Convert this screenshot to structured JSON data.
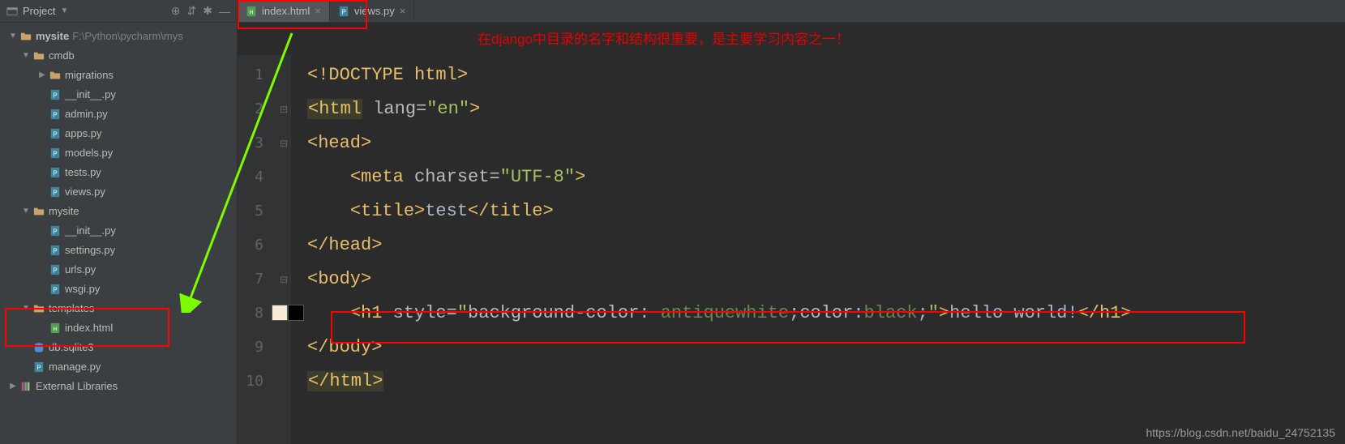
{
  "project_panel": {
    "title": "Project",
    "root": {
      "name": "mysite",
      "path": "F:\\Python\\pycharm\\mys"
    },
    "tree": [
      {
        "label": "cmdb",
        "type": "folder",
        "indent": 1,
        "expanded": true
      },
      {
        "label": "migrations",
        "type": "folder",
        "indent": 2,
        "expanded": false
      },
      {
        "label": "__init__.py",
        "type": "py",
        "indent": 2
      },
      {
        "label": "admin.py",
        "type": "py",
        "indent": 2
      },
      {
        "label": "apps.py",
        "type": "py",
        "indent": 2
      },
      {
        "label": "models.py",
        "type": "py",
        "indent": 2
      },
      {
        "label": "tests.py",
        "type": "py",
        "indent": 2
      },
      {
        "label": "views.py",
        "type": "py",
        "indent": 2
      },
      {
        "label": "mysite",
        "type": "folder",
        "indent": 1,
        "expanded": true
      },
      {
        "label": "__init__.py",
        "type": "py",
        "indent": 2
      },
      {
        "label": "settings.py",
        "type": "py",
        "indent": 2
      },
      {
        "label": "urls.py",
        "type": "py",
        "indent": 2
      },
      {
        "label": "wsgi.py",
        "type": "py",
        "indent": 2
      },
      {
        "label": "templates",
        "type": "folder",
        "indent": 1,
        "expanded": true
      },
      {
        "label": "index.html",
        "type": "html",
        "indent": 2
      },
      {
        "label": "db.sqlite3",
        "type": "db",
        "indent": 1
      },
      {
        "label": "manage.py",
        "type": "py",
        "indent": 1
      }
    ],
    "external_libs": "External Libraries"
  },
  "tabs": [
    {
      "label": "index.html",
      "icon": "html",
      "active": true
    },
    {
      "label": "views.py",
      "icon": "py",
      "active": false
    }
  ],
  "annotation_text": "在django中目录的名字和结构很重要，是主要学习内容之一！",
  "code": {
    "lines": [
      {
        "n": 1,
        "html": "<span class='tag'>&lt;!DOCTYPE html&gt;</span>"
      },
      {
        "n": 2,
        "html": "<span class='tag-open'>&lt;html</span> <span class='attr-name'>lang=</span><span class='attr-val'>\"en\"</span><span class='tag'>&gt;</span>"
      },
      {
        "n": 3,
        "html": "<span class='tag'>&lt;head&gt;</span>"
      },
      {
        "n": 4,
        "html": "    <span class='tag'>&lt;meta</span> <span class='attr-name'>charset=</span><span class='attr-val'>\"UTF-8\"</span><span class='tag'>&gt;</span>"
      },
      {
        "n": 5,
        "html": "    <span class='tag'>&lt;title&gt;</span><span class='text'>test</span><span class='tag'>&lt;/title&gt;</span>"
      },
      {
        "n": 6,
        "html": "<span class='tag'>&lt;/head&gt;</span>"
      },
      {
        "n": 7,
        "html": "<span class='tag'>&lt;body&gt;</span>"
      },
      {
        "n": 8,
        "html": "    <span class='tag'>&lt;h1</span> <span class='attr-name'>style=</span><span class='attr-val'>\"</span><span class='attr-name'>background-color</span><span class='text'>: </span><span class='attr-val2'>antiquewhite</span><span class='text'>;</span><span class='attr-name'>color</span><span class='text'>:</span><span class='attr-val2'>black</span><span class='text'>;</span><span class='attr-val'>\"</span><span class='tag'>&gt;</span><span class='text'>hello world!</span><span class='tag'>&lt;/h1&gt;</span>"
      },
      {
        "n": 9,
        "html": "<span class='tag'>&lt;/body&gt;</span>"
      },
      {
        "n": 10,
        "html": "<span class='tag-open'>&lt;/html&gt;</span>"
      }
    ],
    "fold_marks": [
      false,
      true,
      true,
      false,
      false,
      false,
      true,
      false,
      false,
      false
    ],
    "swatch_line": 8,
    "swatch_colors": [
      "#faebd7",
      "#000000"
    ]
  },
  "watermark": "https://blog.csdn.net/baidu_24752135"
}
